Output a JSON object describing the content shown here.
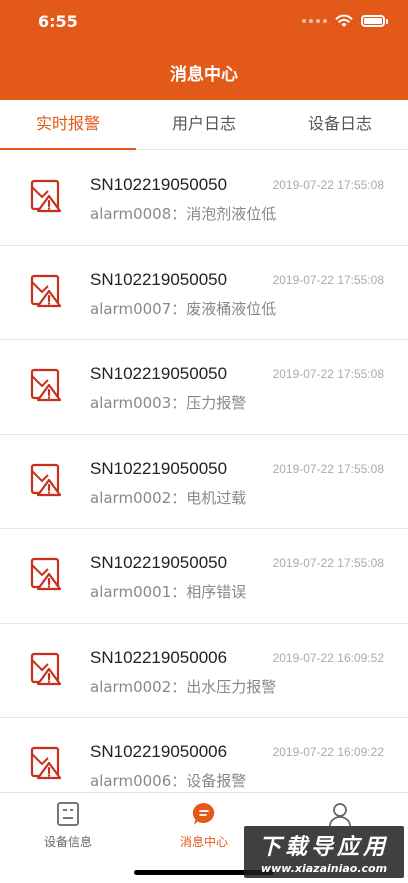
{
  "status": {
    "time": "6:55"
  },
  "header": {
    "title": "消息中心"
  },
  "tabs": [
    {
      "label": "实时报警",
      "active": true
    },
    {
      "label": "用户日志",
      "active": false
    },
    {
      "label": "设备日志",
      "active": false
    }
  ],
  "alarms": [
    {
      "sn": "SN102219050050",
      "time": "2019-07-22 17:55:08",
      "desc": "alarm0008：消泡剂液位低"
    },
    {
      "sn": "SN102219050050",
      "time": "2019-07-22 17:55:08",
      "desc": "alarm0007：废液桶液位低"
    },
    {
      "sn": "SN102219050050",
      "time": "2019-07-22 17:55:08",
      "desc": "alarm0003：压力报警"
    },
    {
      "sn": "SN102219050050",
      "time": "2019-07-22 17:55:08",
      "desc": "alarm0002：电机过载"
    },
    {
      "sn": "SN102219050050",
      "time": "2019-07-22 17:55:08",
      "desc": "alarm0001：相序错误"
    },
    {
      "sn": "SN102219050006",
      "time": "2019-07-22 16:09:52",
      "desc": "alarm0002：出水压力报警"
    },
    {
      "sn": "SN102219050006",
      "time": "2019-07-22 16:09:22",
      "desc": "alarm0006：设备报警"
    }
  ],
  "tabbar": [
    {
      "label": "设备信息",
      "icon": "device-info-icon",
      "active": false
    },
    {
      "label": "消息中心",
      "icon": "message-icon",
      "active": true
    },
    {
      "label": "",
      "icon": "user-icon",
      "active": false
    }
  ],
  "watermark": {
    "title": "下载导应用",
    "url": "www.xiazainiao.com"
  },
  "colors": {
    "accent": "#E2591A",
    "alarm_icon": "#C8301E"
  }
}
